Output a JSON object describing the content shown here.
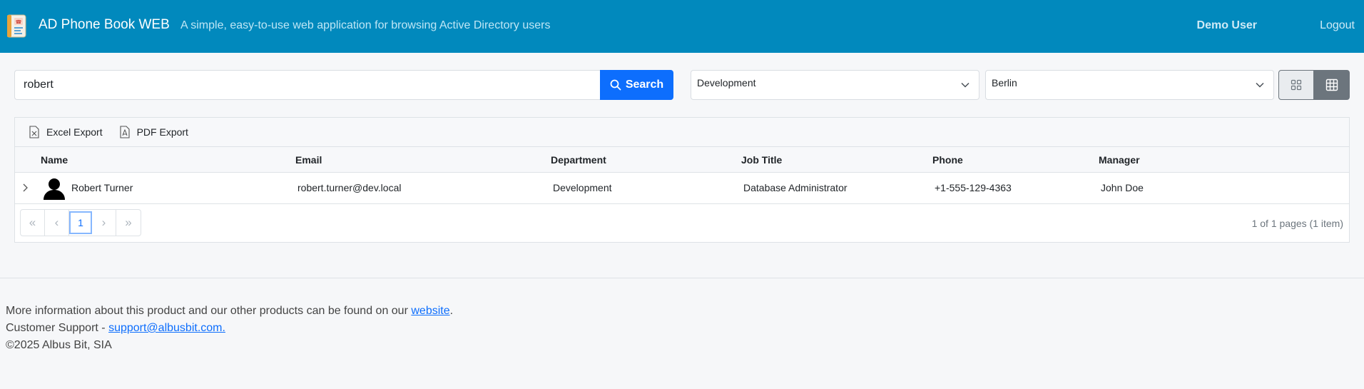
{
  "header": {
    "title": "AD Phone Book WEB",
    "subtitle": "A simple, easy-to-use web application for browsing Active Directory users",
    "user": "Demo User",
    "logout": "Logout"
  },
  "search": {
    "value": "robert",
    "button_label": "Search"
  },
  "filters": {
    "department": "Development",
    "city": "Berlin"
  },
  "toolbar": {
    "excel_label": "Excel Export",
    "pdf_label": "PDF Export"
  },
  "table": {
    "columns": [
      "Name",
      "Email",
      "Department",
      "Job Title",
      "Phone",
      "Manager"
    ],
    "rows": [
      {
        "name": "Robert Turner",
        "email": "robert.turner@dev.local",
        "department": "Development",
        "job_title": "Database Administrator",
        "phone": "+1-555-129-4363",
        "manager": "John Doe"
      }
    ]
  },
  "pager": {
    "first": "«",
    "prev": "‹",
    "current": "1",
    "next": "›",
    "last": "»",
    "info": "1 of 1 pages (1 item)"
  },
  "footer": {
    "line1_prefix": "More information about this product and our other products can be found on our ",
    "line1_link": "website",
    "line1_suffix": ".",
    "line2_prefix": "Customer Support - ",
    "line2_link": "support@albusbit.com.",
    "line3": "©2025 Albus Bit, SIA"
  },
  "colors": {
    "header_bg": "#0189bd",
    "primary": "#0d6efd"
  }
}
